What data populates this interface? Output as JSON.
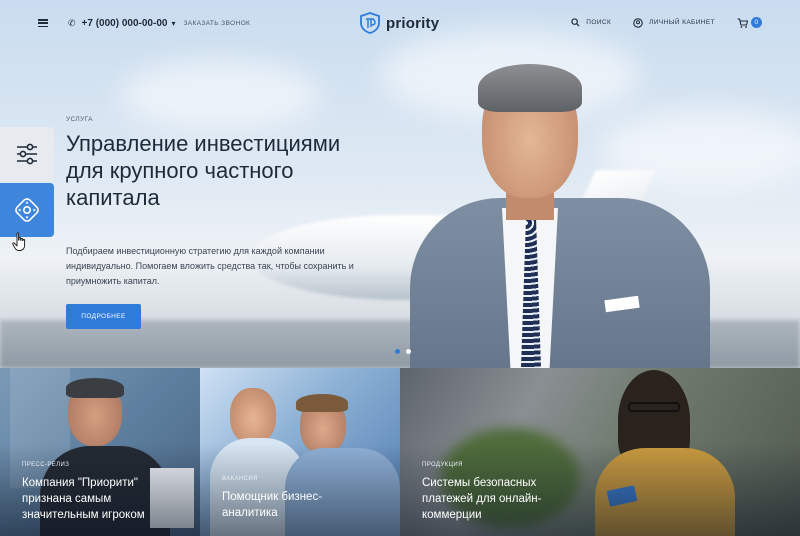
{
  "header": {
    "phone": "+7 (000) 000-00-00",
    "callback": "ЗАКАЗАТЬ ЗВОНОК",
    "brand": "priority",
    "search": "ПОИСК",
    "account": "ЛИЧНЫЙ КАБИНЕТ",
    "cart_count": "0"
  },
  "hero": {
    "eyebrow": "УСЛУГА",
    "title": "Управление инвестициями для крупного частного капитала",
    "description": "Подбираем инвестиционную стратегию для каждой компании индивидуально. Помогаем вложить средства так, чтобы сохранить и приумножить капитал.",
    "cta": "ПОДРОБНЕЕ",
    "slides_total": 2,
    "slide_active": 1
  },
  "cards": [
    {
      "tag": "ПРЕСС-РЕЛИЗ",
      "title": "Компания \"Приорити\" признана самым значительным игроком"
    },
    {
      "tag": "ВАКАНСИЯ",
      "title": "Помощник бизнес-аналитика"
    },
    {
      "tag": "ПРОДУКЦИЯ",
      "title": "Системы безопасных платежей для онлайн-коммерции"
    }
  ],
  "colors": {
    "accent": "#2f7bd9",
    "text": "#1f2a38"
  }
}
